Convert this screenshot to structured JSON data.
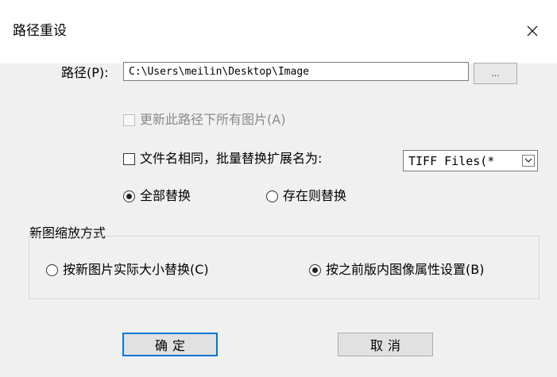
{
  "dialog": {
    "title": "路径重设",
    "close_glyph": "✕"
  },
  "path": {
    "label": "路径(P):",
    "value": "C:\\Users\\meilin\\Desktop\\Image",
    "browse_label": "..."
  },
  "update_all": {
    "label": "更新此路径下所有图片(A)",
    "checked": false,
    "enabled": false
  },
  "same_name": {
    "label": "文件名相同，批量替换扩展名为:",
    "checked": false
  },
  "extension_select": {
    "value": "TIFF Files(*"
  },
  "replace_mode": {
    "options": [
      {
        "label": "全部替换",
        "checked": true
      },
      {
        "label": "存在则替换",
        "checked": false
      }
    ]
  },
  "scale_group": {
    "title": "新图缩放方式",
    "options": [
      {
        "label": "按新图片实际大小替换(C)",
        "checked": false
      },
      {
        "label": "按之前版内图像属性设置(B)",
        "checked": true
      }
    ]
  },
  "buttons": {
    "ok": "确定",
    "cancel": "取消"
  },
  "colors": {
    "background": "#f0f0f0",
    "default_button_border": "#0078d7"
  }
}
